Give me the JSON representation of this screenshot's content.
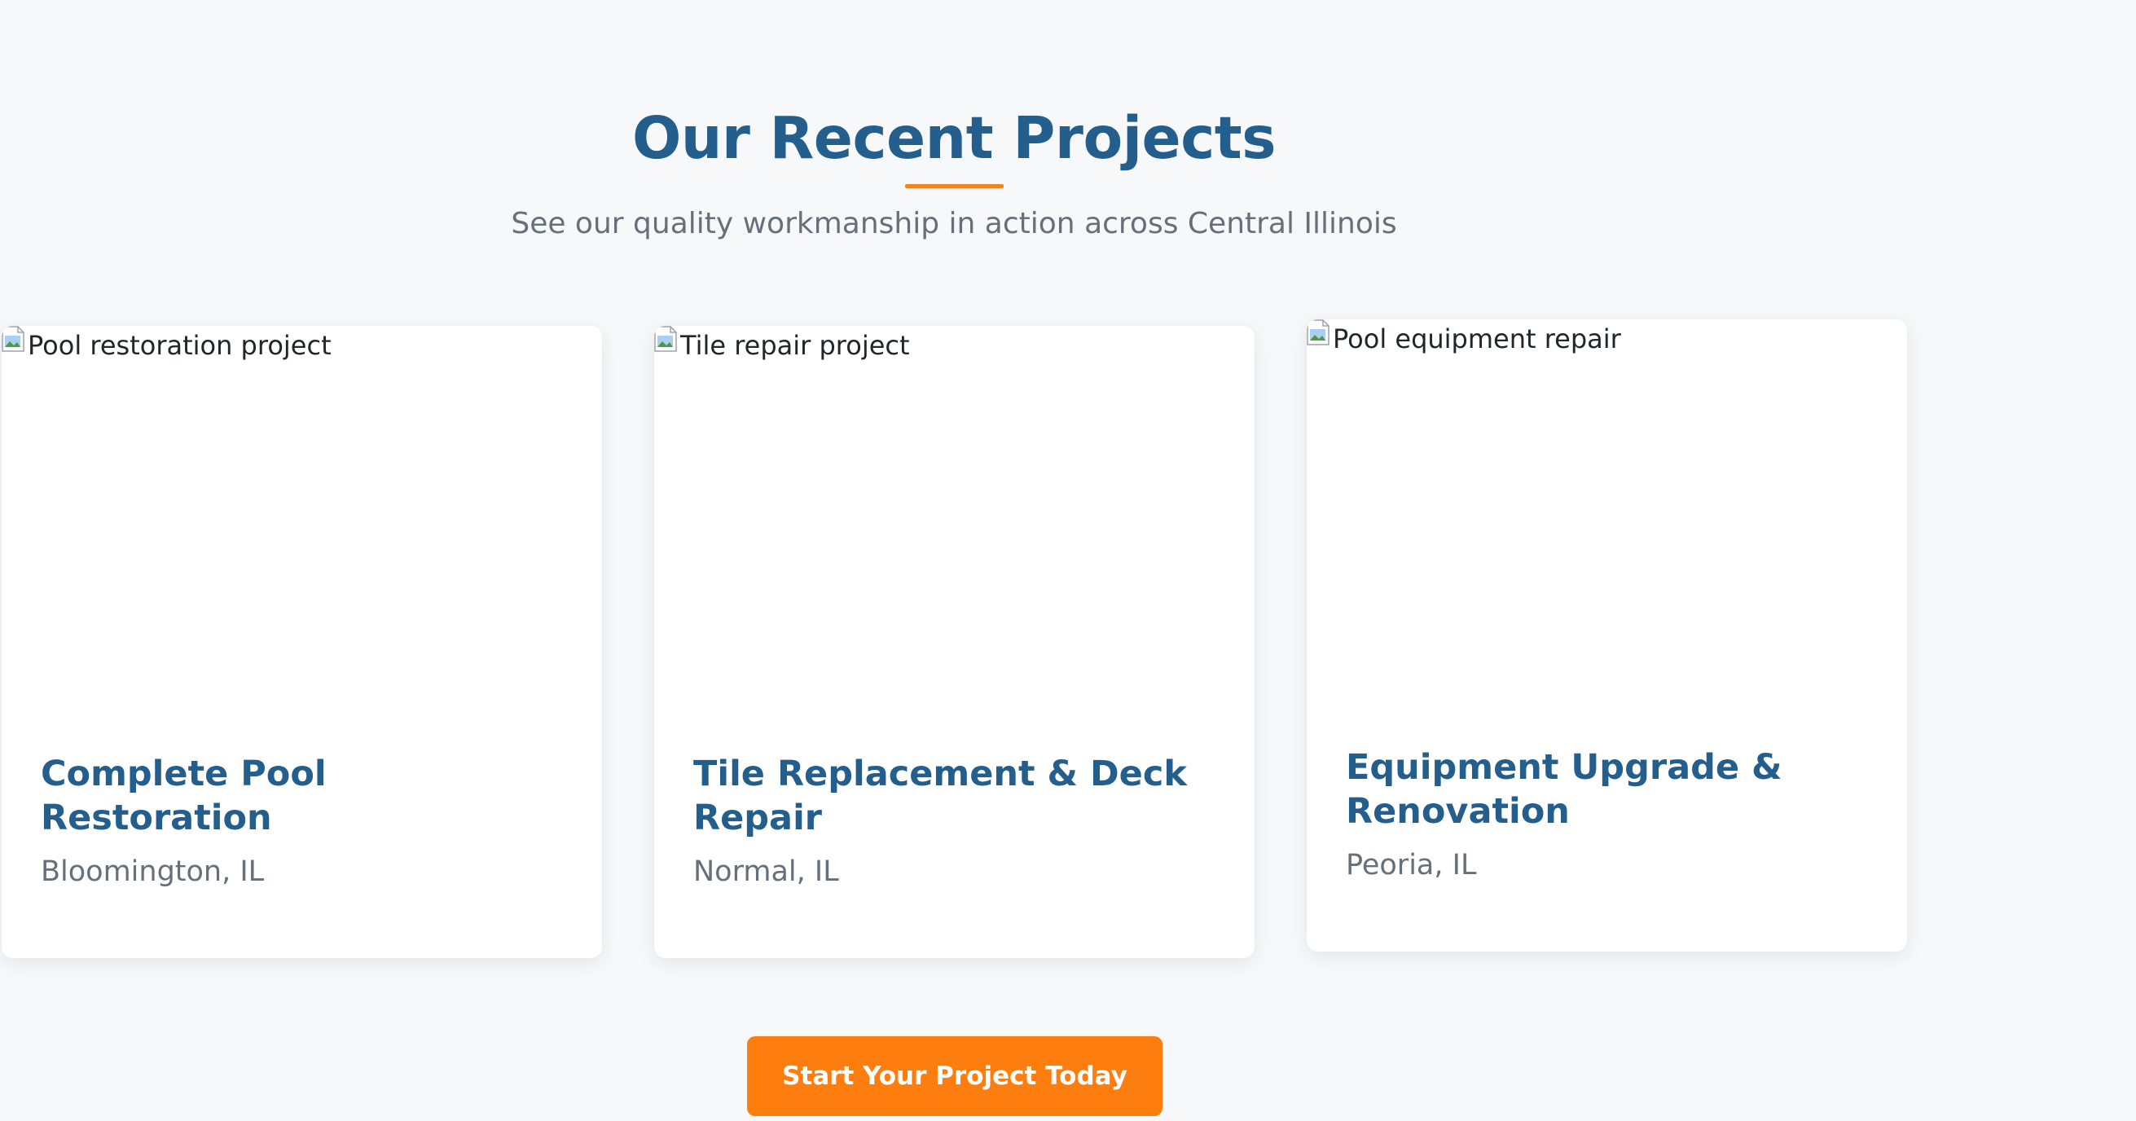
{
  "section": {
    "title": "Our Recent Projects",
    "subtitle": "See our quality workmanship in action across Central Illinois"
  },
  "projects": [
    {
      "image_alt": "Pool restoration project",
      "title": "Complete Pool Restoration",
      "location": "Bloomington, IL"
    },
    {
      "image_alt": "Tile repair project",
      "title": "Tile Replacement & Deck Repair",
      "location": "Normal, IL"
    },
    {
      "image_alt": "Pool equipment repair",
      "title": "Equipment Upgrade & Renovation",
      "location": "Peoria, IL"
    }
  ],
  "cta": {
    "label": "Start Your Project Today"
  },
  "colors": {
    "heading": "#235e8c",
    "accent": "#f5821f",
    "button": "#fd7e0f",
    "muted_text": "#66707a",
    "background": "#f7f8fa"
  }
}
